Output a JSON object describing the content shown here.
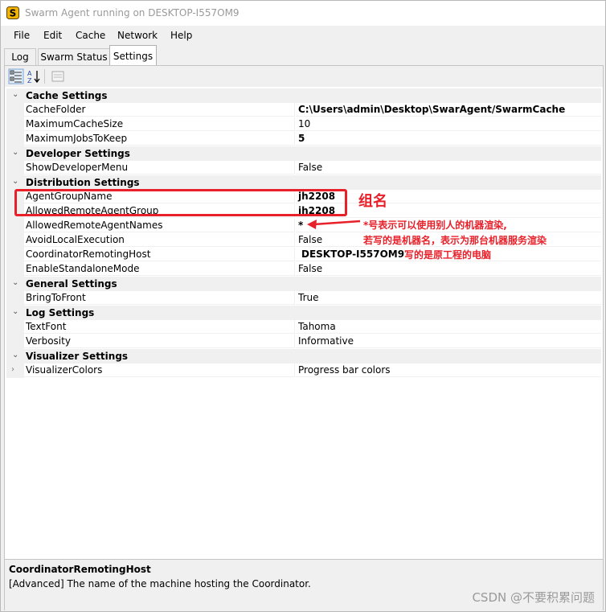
{
  "window": {
    "title": "Swarm Agent running on DESKTOP-I557OM9"
  },
  "menu": [
    "File",
    "Edit",
    "Cache",
    "Network",
    "Help"
  ],
  "tabs": {
    "log": "Log",
    "swarm_status": "Swarm Status",
    "settings": "Settings"
  },
  "categories": {
    "cache": "Cache Settings",
    "developer": "Developer Settings",
    "distribution": "Distribution Settings",
    "general": "General Settings",
    "log": "Log Settings",
    "visualizer": "Visualizer Settings"
  },
  "props": {
    "cache_folder": {
      "name": "CacheFolder",
      "value": "C:\\Users\\admin\\Desktop\\SwarAgent/SwarmCache"
    },
    "max_cache_size": {
      "name": "MaximumCacheSize",
      "value": "10"
    },
    "max_jobs": {
      "name": "MaximumJobsToKeep",
      "value": "5"
    },
    "show_dev_menu": {
      "name": "ShowDeveloperMenu",
      "value": "False"
    },
    "agent_group_name": {
      "name": "AgentGroupName",
      "value": "jh2208"
    },
    "allowed_remote_group": {
      "name": "AllowedRemoteAgentGroup",
      "value": "jh2208"
    },
    "allowed_remote_names": {
      "name": "AllowedRemoteAgentNames",
      "value": "*"
    },
    "avoid_local": {
      "name": "AvoidLocalExecution",
      "value": "False"
    },
    "coordinator_host": {
      "name": "CoordinatorRemotingHost",
      "value": "DESKTOP-I557OM9"
    },
    "standalone": {
      "name": "EnableStandaloneMode",
      "value": "False"
    },
    "bring_to_front": {
      "name": "BringToFront",
      "value": "True"
    },
    "text_font": {
      "name": "TextFont",
      "value": "Tahoma"
    },
    "verbosity": {
      "name": "Verbosity",
      "value": "Informative"
    },
    "visualizer_colors": {
      "name": "VisualizerColors",
      "value": "Progress bar colors"
    }
  },
  "help": {
    "title": "CoordinatorRemotingHost",
    "description": "[Advanced] The name of the machine hosting the Coordinator."
  },
  "annotations": {
    "group_label": "组名",
    "note_line1": "*号表示可以使用别人的机器渲染,",
    "note_line2": "若写的是机器名，表示为那台机器服务渲染",
    "note_line3": "写的是原工程的电脑",
    "color": "#e8202a"
  },
  "watermark": "CSDN @不要积累问题"
}
